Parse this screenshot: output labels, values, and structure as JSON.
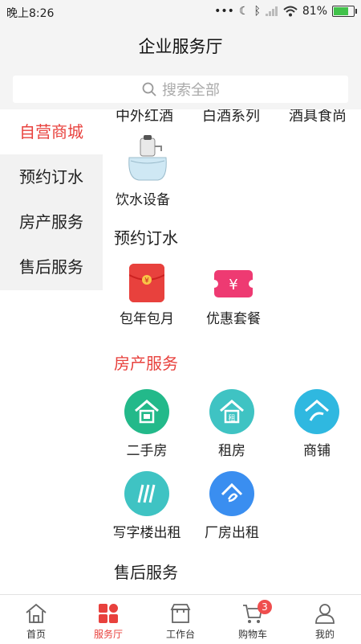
{
  "status_bar": {
    "time": "晚上8:26",
    "battery": "81%",
    "battery_level": 0.81
  },
  "header": {
    "title": "企业服务厅"
  },
  "search": {
    "placeholder": "搜索全部"
  },
  "sidebar": {
    "items": [
      {
        "label": "自营商城",
        "active": true
      },
      {
        "label": "预约订水",
        "active": false
      },
      {
        "label": "房产服务",
        "active": false
      },
      {
        "label": "售后服务",
        "active": false
      }
    ]
  },
  "content": {
    "cut_row": [
      "中外红酒",
      "白酒系列",
      "酒具食尚"
    ],
    "mall_items": [
      {
        "label": "饮水设备",
        "icon": "water-dispenser-icon"
      }
    ],
    "sections": [
      {
        "title": "预约订水",
        "color": "#222222",
        "items": [
          {
            "label": "包年包月",
            "icon": "red-envelope-icon",
            "color": "#e8413d"
          },
          {
            "label": "优惠套餐",
            "icon": "coupon-icon",
            "color": "#ee3a72"
          }
        ]
      },
      {
        "title": "房产服务",
        "color": "#e8413d",
        "items": [
          {
            "label": "二手房",
            "icon": "house-icon",
            "color": "#23b98a"
          },
          {
            "label": "租房",
            "icon": "rent-house-icon",
            "color": "#3fc3c3"
          },
          {
            "label": "商铺",
            "icon": "shop-icon",
            "color": "#2fb8e0"
          },
          {
            "label": "写字楼出租",
            "icon": "office-icon",
            "color": "#3fc3c3"
          },
          {
            "label": "厂房出租",
            "icon": "factory-icon",
            "color": "#3a8ef0"
          }
        ]
      },
      {
        "title": "售后服务",
        "color": "#222222",
        "items": []
      }
    ]
  },
  "tabbar": {
    "items": [
      {
        "label": "首页",
        "icon": "home-icon",
        "active": false
      },
      {
        "label": "服务厅",
        "icon": "service-grid-icon",
        "active": true
      },
      {
        "label": "工作台",
        "icon": "workbench-icon",
        "active": false
      },
      {
        "label": "购物车",
        "icon": "cart-icon",
        "active": false,
        "badge": "3"
      },
      {
        "label": "我的",
        "icon": "profile-icon",
        "active": false
      }
    ]
  },
  "colors": {
    "accent": "#e8413d"
  }
}
